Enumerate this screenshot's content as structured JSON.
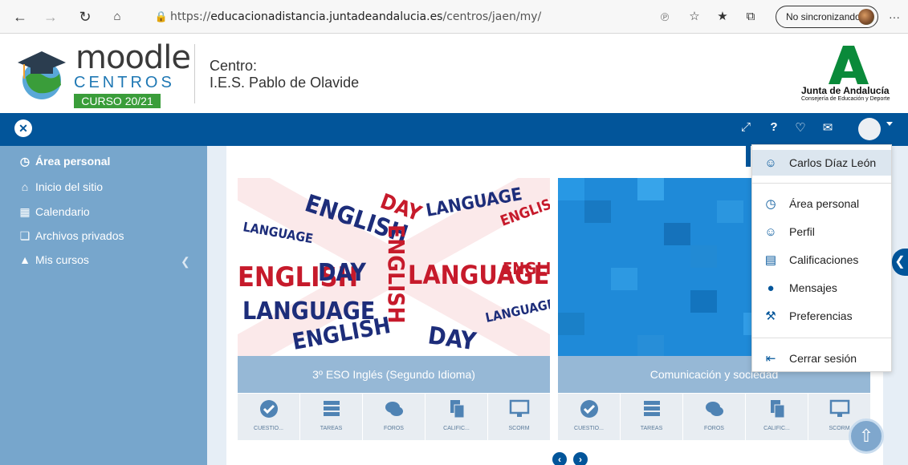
{
  "browser": {
    "url_prefix": "https://",
    "url_host": "educacionadistancia.juntadeandalucia.es",
    "url_path": "/centros/jaen/my/",
    "sync_label": "No sincronizando",
    "more_label": "···"
  },
  "header": {
    "logo_moodle": "moodle",
    "logo_centros": "CENTROS",
    "logo_curso": "CURSO 20/21",
    "centro_label": "Centro:",
    "centro_name": "I.E.S. Pablo de Olavide",
    "ja_title": "Junta de Andalucía",
    "ja_subtitle": "Consejería de Educación y Deporte"
  },
  "sidebar": {
    "items": [
      {
        "label": "Área personal",
        "icon": "dashboard-icon"
      },
      {
        "label": "Inicio del sitio",
        "icon": "home-icon"
      },
      {
        "label": "Calendario",
        "icon": "calendar-icon"
      },
      {
        "label": "Archivos privados",
        "icon": "files-icon"
      },
      {
        "label": "Mis cursos",
        "icon": "graduation-cap-icon"
      }
    ]
  },
  "courses": [
    {
      "title": "3º ESO Inglés (Segundo Idioma)"
    },
    {
      "title": "Comunicación y sociedad"
    }
  ],
  "course_actions": [
    "CUESTIO...",
    "TAREAS",
    "FOROS",
    "CALIFIC...",
    "SCORM"
  ],
  "wordcloud": {
    "words": [
      "ENGLISH",
      "LANGUAGE",
      "DAY",
      "ENGLISH",
      "LANGUAGE",
      "ENGLISH",
      "DAY",
      "LANGUAGE",
      "ENGLISH",
      "LANGUAGE",
      "ENGLISH",
      "DAY",
      "LANGUAGE",
      "ENGLISH"
    ]
  },
  "user_menu": {
    "username": "Carlos Díaz León",
    "items": [
      {
        "label": "Área personal",
        "icon": "dashboard-icon"
      },
      {
        "label": "Perfil",
        "icon": "user-icon"
      },
      {
        "label": "Calificaciones",
        "icon": "grades-icon"
      },
      {
        "label": "Mensajes",
        "icon": "message-icon"
      },
      {
        "label": "Preferencias",
        "icon": "wrench-icon"
      }
    ],
    "logout_label": "Cerrar sesión"
  },
  "colors": {
    "navbar": "#02559a",
    "sidebar": "#77a6cc",
    "card_title": "#96b8d6"
  }
}
